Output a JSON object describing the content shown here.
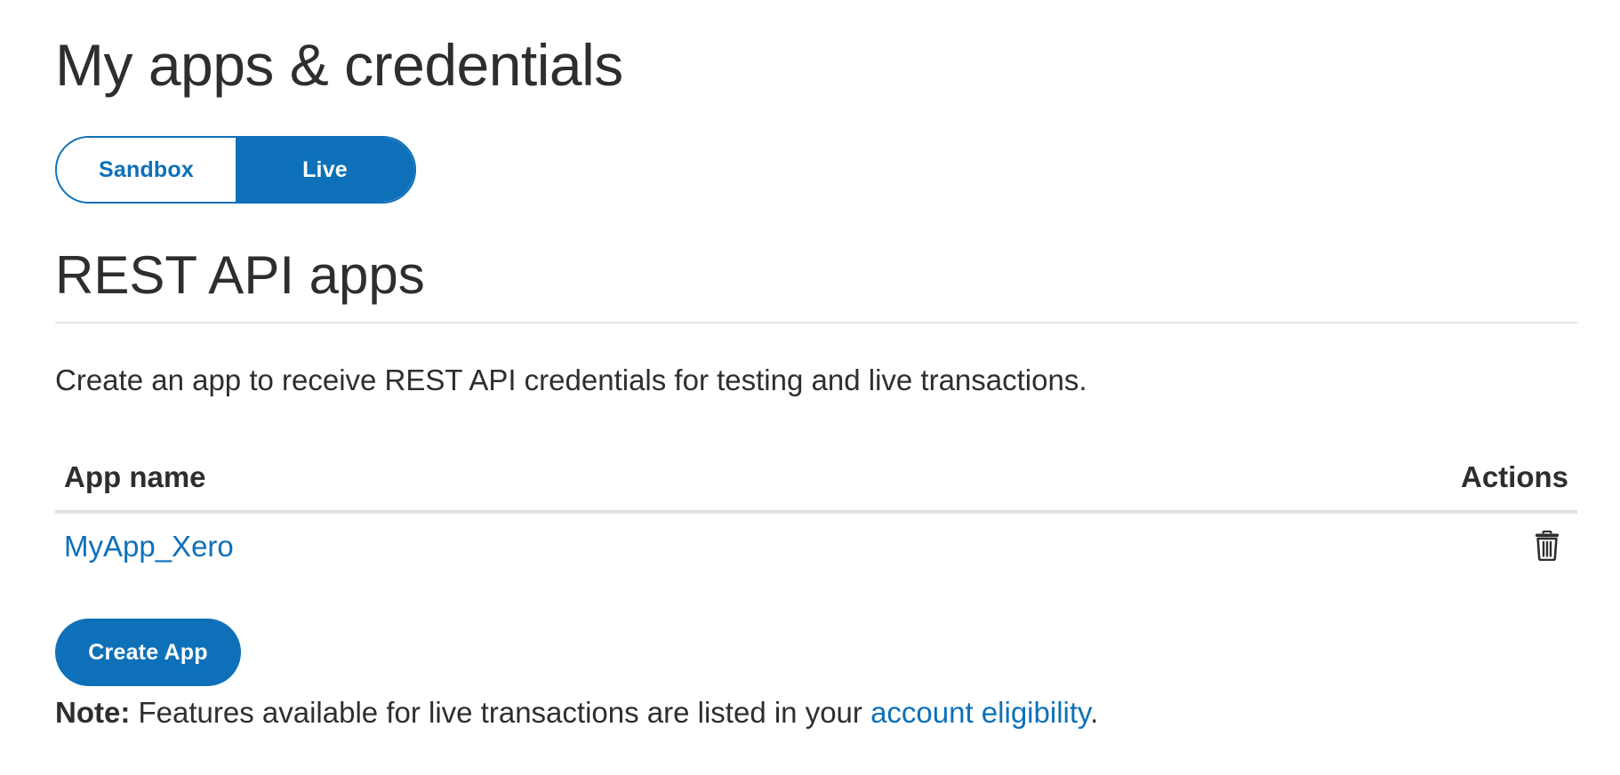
{
  "page": {
    "title": "My apps & credentials"
  },
  "environment_toggle": {
    "options": [
      {
        "label": "Sandbox",
        "selected": false
      },
      {
        "label": "Live",
        "selected": true
      }
    ]
  },
  "section": {
    "title": "REST API apps",
    "description": "Create an app to receive REST API credentials for testing and live transactions."
  },
  "apps_table": {
    "columns": [
      "App name",
      "Actions"
    ],
    "rows": [
      {
        "app_name": "MyApp_Xero",
        "action_icon": "trash-icon"
      }
    ]
  },
  "create_button": {
    "label": "Create App"
  },
  "note": {
    "prefix": "Note:",
    "text": " Features available for live transactions are listed in your ",
    "link_text": "account eligibility",
    "suffix": "."
  },
  "colors": {
    "brand_blue": "#0e70b9",
    "text_dark": "#2c2e2f",
    "divider": "#e2e4e5"
  }
}
